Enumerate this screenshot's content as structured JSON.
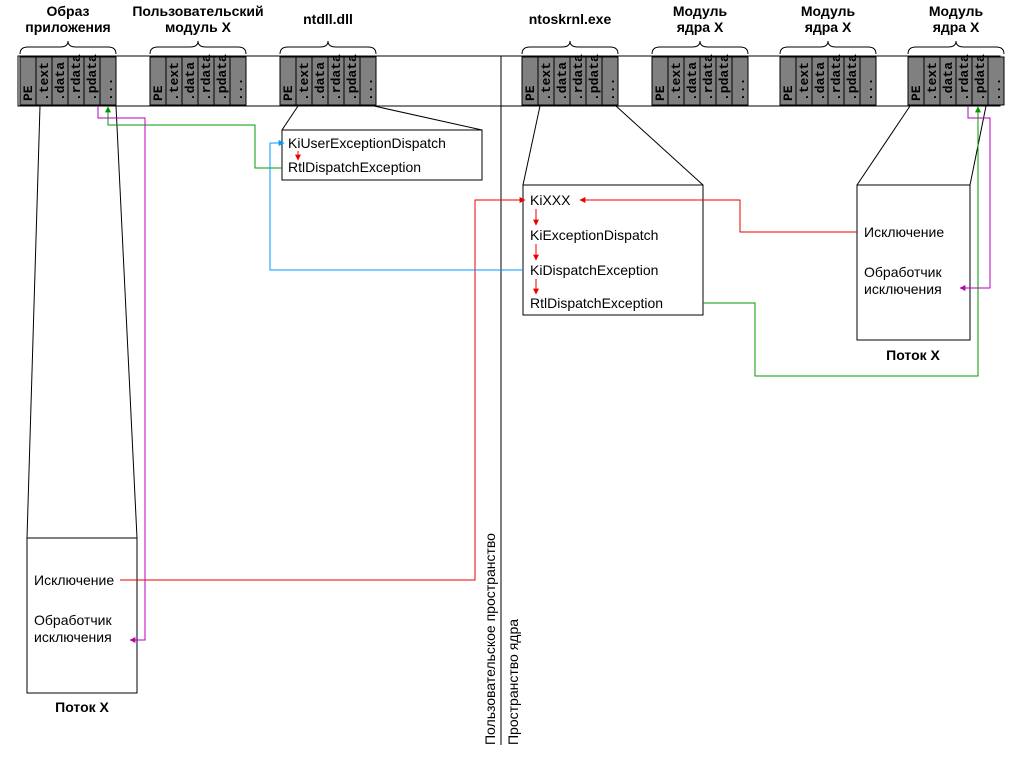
{
  "sections": [
    "PE",
    ".text",
    ".data",
    ".rdata",
    ".pdata",
    "..."
  ],
  "modules": [
    {
      "id": "app",
      "label1": "Образ",
      "label2": "приложения"
    },
    {
      "id": "user",
      "label1": "Пользовательский",
      "label2": "модуль X"
    },
    {
      "id": "ntdll",
      "label1": "ntdll.dll",
      "label2": ""
    },
    {
      "id": "ntos",
      "label1": "ntoskrnl.exe",
      "label2": ""
    },
    {
      "id": "k1",
      "label1": "Модуль",
      "label2": "ядра X"
    },
    {
      "id": "k2",
      "label1": "Модуль",
      "label2": "ядра X"
    },
    {
      "id": "k3",
      "label1": "Модуль",
      "label2": "ядра X"
    }
  ],
  "ntdll_box": {
    "line1": "KiUserExceptionDispatch",
    "line2": "RtlDispatchException"
  },
  "ntos_box": {
    "line1": "KiXXX",
    "line2": "KiExceptionDispatch",
    "line3": "KiDispatchException",
    "line4": "RtlDispatchException"
  },
  "thread_box": {
    "line1": "Исключение",
    "line2": "Обработчик",
    "line3": "исключения"
  },
  "thread_label": "Поток X",
  "space": {
    "user": "Пользовательское пространство",
    "kernel": "Пространство ядра"
  }
}
